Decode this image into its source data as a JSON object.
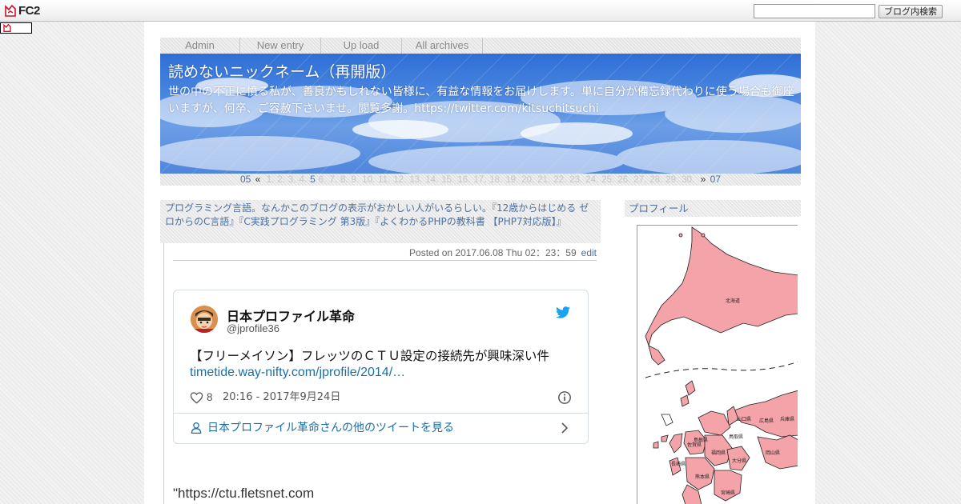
{
  "fc2": {
    "logo_text": "FC2",
    "search_value": "",
    "search_button": "ブログ内検索"
  },
  "nav": {
    "items": [
      "Admin",
      "New entry",
      "Up load",
      "All archives"
    ]
  },
  "blog": {
    "title": "読めないニックネーム（再開版）",
    "description": "世の中の不正に憤る私が、善良かもしれない皆様に、有益な情報をお届けします。単に自分が備忘録代わりに使う場合も御座いますが、何卒、ご容赦下さいませ。閲覧多謝。https://twitter.com/kitsuchitsuchi"
  },
  "date_nav": {
    "prev_month": "05",
    "prev_arrow": "«",
    "next_arrow": "»",
    "next_month": "07",
    "days": [
      "1.",
      "2.",
      "3.",
      "4.",
      "5",
      "6.",
      "7.",
      "8.",
      "9.",
      "10.",
      "11.",
      "12.",
      "13.",
      "14.",
      "15.",
      "16.",
      "17.",
      "18.",
      "19.",
      "20.",
      "21.",
      "22.",
      "23.",
      "24.",
      "25.",
      "26.",
      "27.",
      "28.",
      "29.",
      "30."
    ],
    "active_day": "5"
  },
  "entry": {
    "title": "プログラミング言語。なんかこのブログの表示がおかしい人がいるらしい。『12歳からはじめる ゼロからのC言語』『C実践プログラミング 第3版』『よくわかるPHPの教科書 【PHP7対応版】』",
    "posted": "Posted on 2017.06.08 Thu 02：23：59",
    "edit": "edit",
    "body_start": "\"https://ctu.fletsnet.com"
  },
  "tweet": {
    "name": "日本プロファイル革命",
    "handle": "@jprofile36",
    "text": "【フリーメイソン】フレッツのＣＴＵ設定の接続先が興味深い件",
    "link": "timetide.way-nifty.com/jprofile/2014/…",
    "likes": "8",
    "datetime": "20:16 - 2017年9月24日",
    "more": "日本プロファイル革命さんの他のツイートを見る"
  },
  "sidebar": {
    "profile_title": "プロフィール",
    "map_labels": [
      "北海道",
      "島根県",
      "鳥取県",
      "岡山県",
      "兵庫県",
      "山口県",
      "広島県",
      "福岡県",
      "大分県",
      "宮崎県",
      "熊本県",
      "長崎県",
      "佐賀県"
    ]
  },
  "colors": {
    "link": "#4a6fa0",
    "banner_sky": "#4a86e0",
    "map_fill": "#f4a3a8",
    "twitter_blue": "#1da1f2"
  }
}
